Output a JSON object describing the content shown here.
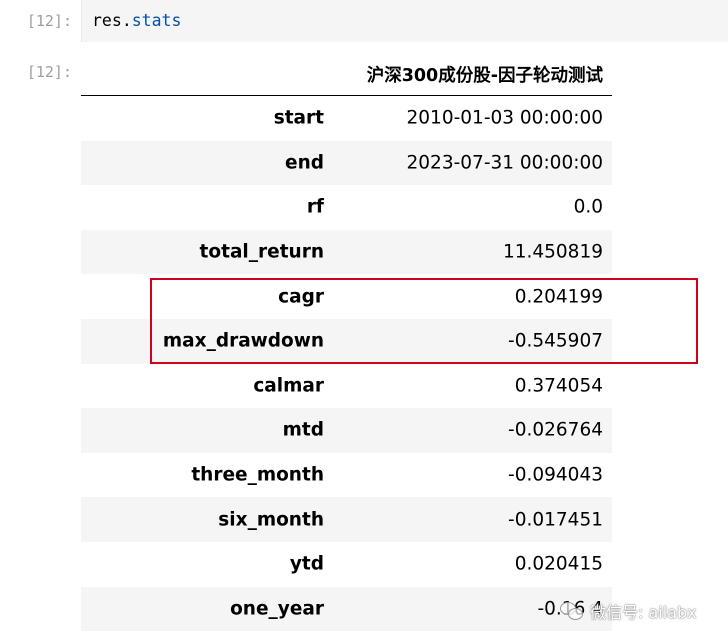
{
  "cells": {
    "input_prompt": "[12]:",
    "output_prompt": "[12]:",
    "code_object": "res",
    "code_dot": ".",
    "code_attr": "stats"
  },
  "table": {
    "column_header": "沪深300成份股-因子轮动测试",
    "rows": [
      {
        "key": "start",
        "value": "2010-01-03 00:00:00"
      },
      {
        "key": "end",
        "value": "2023-07-31 00:00:00"
      },
      {
        "key": "rf",
        "value": "0.0"
      },
      {
        "key": "total_return",
        "value": "11.450819"
      },
      {
        "key": "cagr",
        "value": "0.204199"
      },
      {
        "key": "max_drawdown",
        "value": "-0.545907"
      },
      {
        "key": "calmar",
        "value": "0.374054"
      },
      {
        "key": "mtd",
        "value": "-0.026764"
      },
      {
        "key": "three_month",
        "value": "-0.094043"
      },
      {
        "key": "six_month",
        "value": "-0.017451"
      },
      {
        "key": "ytd",
        "value": "0.020415"
      },
      {
        "key": "one_year",
        "value": "-0.16   4"
      }
    ]
  },
  "highlight_color": "#d0021b",
  "watermark": {
    "icon": "wechat-icon",
    "text": "微信号: ailabx"
  }
}
